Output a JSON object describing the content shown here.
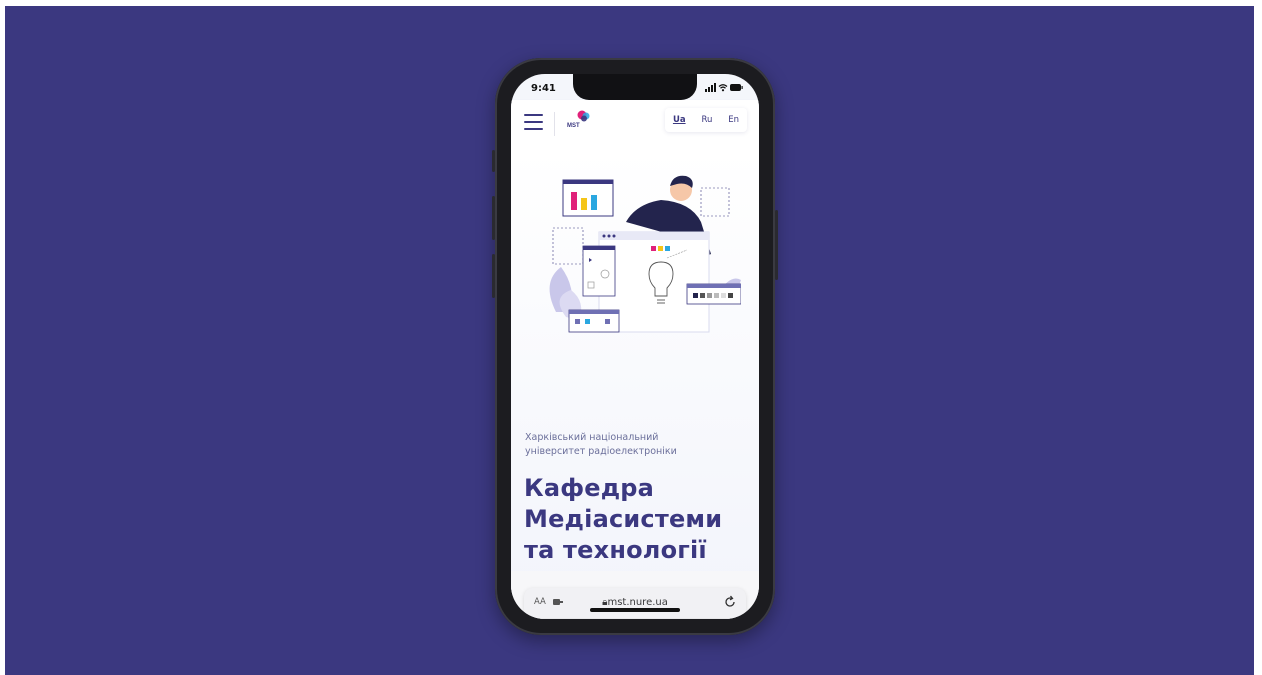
{
  "status": {
    "time": "9:41",
    "icons": "▂▄▆ ◠ ▬"
  },
  "header": {
    "logo": {
      "text": "MST",
      "icon": "logo-icon"
    },
    "languages": [
      {
        "label": "Ua",
        "active": true
      },
      {
        "label": "Ru",
        "active": false
      },
      {
        "label": "En",
        "active": false
      }
    ]
  },
  "hero": {
    "subtitle_line1": "Харківський національний",
    "subtitle_line2": "університет радіоелектроніки",
    "title_line1": "Кафедра",
    "title_line2": "Медіасистеми",
    "title_line3": "та технології"
  },
  "browser": {
    "aa_label": "AA",
    "url": "mst.nure.ua",
    "toolbar": [
      "back-icon",
      "forward-icon",
      "share-icon",
      "bookmarks-icon",
      "tabs-icon"
    ]
  },
  "colors": {
    "background": "#3b3880",
    "title": "#3b3880",
    "subtitle": "#6b6f9a",
    "accent_blue": "#1f7aff"
  }
}
